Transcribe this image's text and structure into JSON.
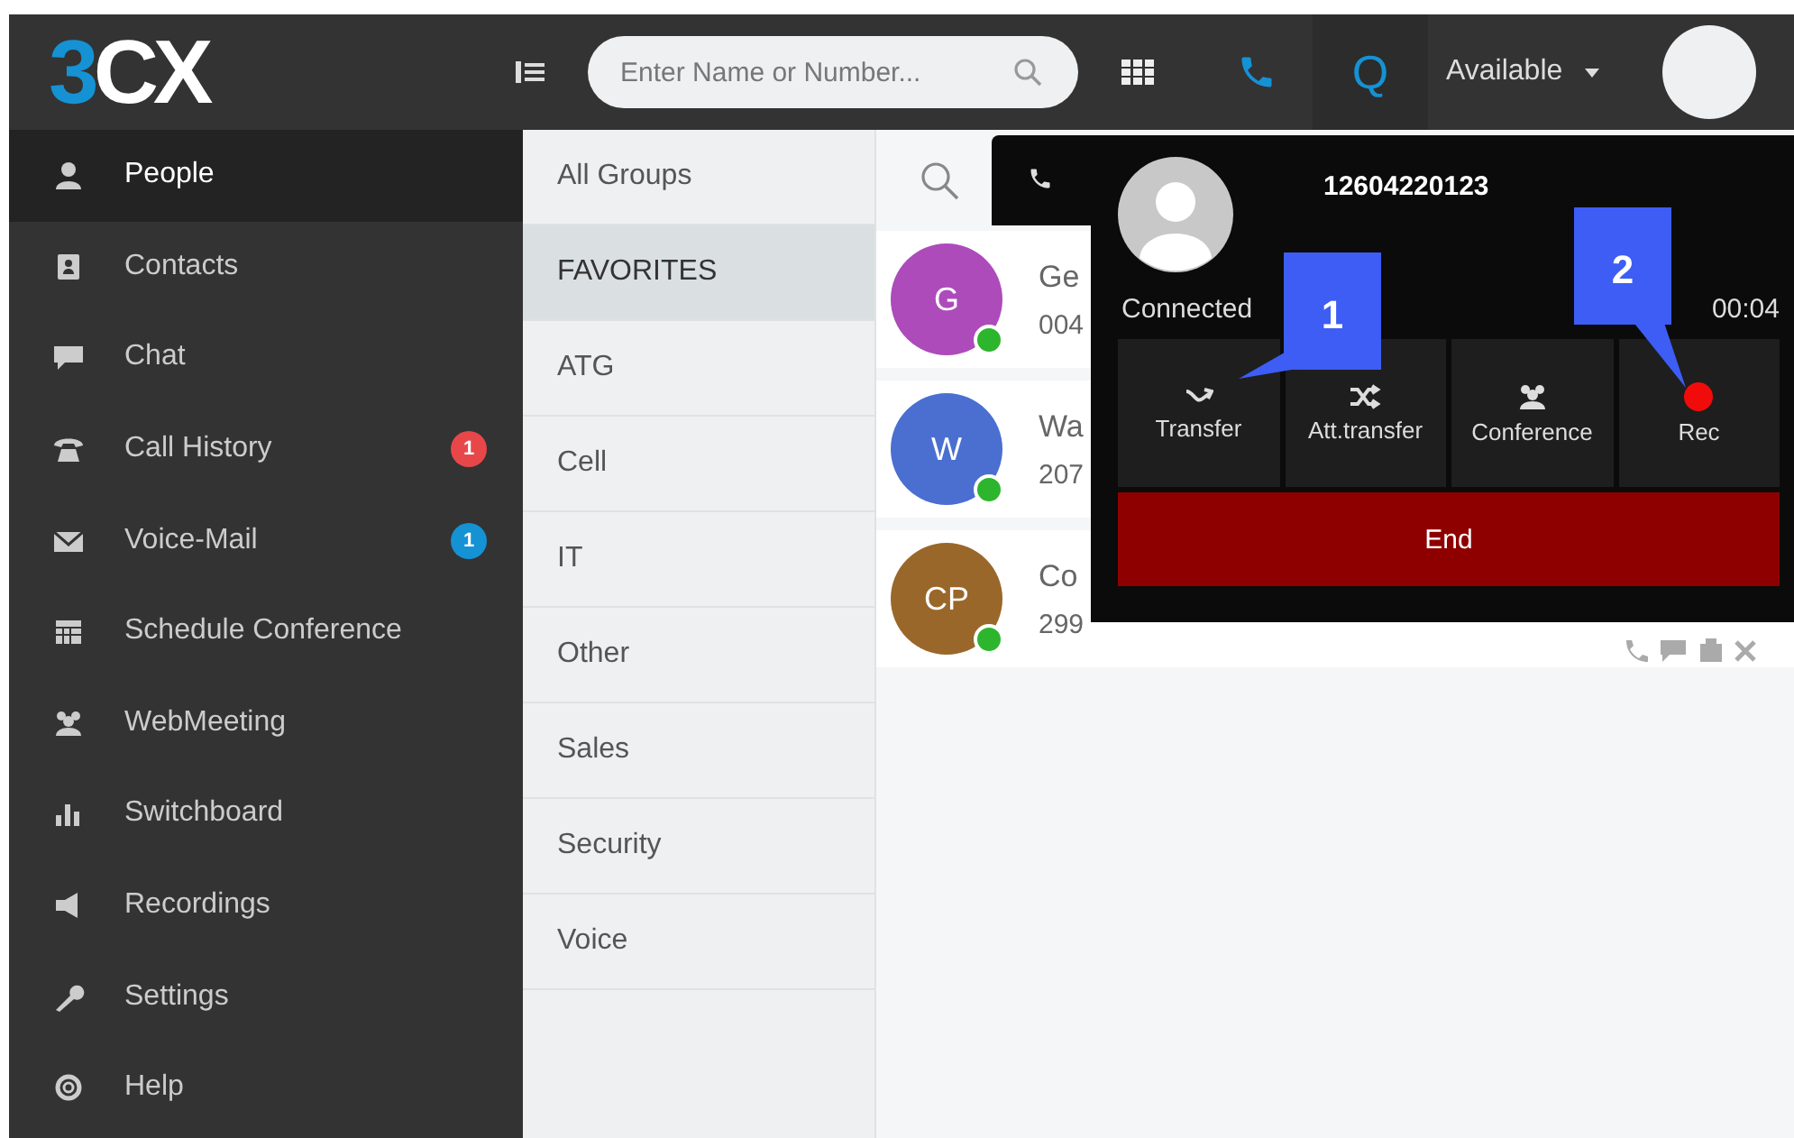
{
  "topbar": {
    "logo": {
      "accent": "3",
      "rest": "CX"
    },
    "search": {
      "placeholder": "Enter Name or Number..."
    },
    "queue_label": "Q",
    "status": "Available"
  },
  "sidebar": {
    "items": [
      {
        "label": "People",
        "selected": true
      },
      {
        "label": "Contacts",
        "selected": false
      },
      {
        "label": "Chat",
        "selected": false
      },
      {
        "label": "Call History",
        "selected": false,
        "badge": "1",
        "color": "#e8474a"
      },
      {
        "label": "Voice-Mail",
        "selected": false,
        "badge": "1",
        "color": "#1592d4"
      },
      {
        "label": "Schedule Conference",
        "selected": false
      },
      {
        "label": "WebMeeting",
        "selected": false
      },
      {
        "label": "Switchboard",
        "selected": false
      },
      {
        "label": "Recordings",
        "selected": false
      },
      {
        "label": "Settings",
        "selected": false
      },
      {
        "label": "Help",
        "selected": false
      }
    ]
  },
  "groups": [
    {
      "label": "All Groups",
      "selected": false
    },
    {
      "label": "FAVORITES",
      "selected": true
    },
    {
      "label": "ATG",
      "selected": false
    },
    {
      "label": "Cell",
      "selected": false
    },
    {
      "label": "IT",
      "selected": false
    },
    {
      "label": "Other",
      "selected": false
    },
    {
      "label": "Sales",
      "selected": false
    },
    {
      "label": "Security",
      "selected": false
    },
    {
      "label": "Voice",
      "selected": false
    }
  ],
  "contacts": [
    {
      "initials": "G",
      "color": "#ad4bbb",
      "name": "Ge",
      "number": "004",
      "online": true,
      "actions_visible": false
    },
    {
      "initials": "W",
      "color": "#4a6fd1",
      "name": "Wa",
      "number": "207",
      "online": true,
      "actions_visible": false
    },
    {
      "initials": "CP",
      "color": "#9a672a",
      "name": "Co",
      "number": "299",
      "online": true,
      "actions_visible": true
    }
  ],
  "call": {
    "number": "12604220123",
    "state": "Connected",
    "duration": "00:04",
    "actions": [
      {
        "kind": "transfer",
        "label": "Transfer"
      },
      {
        "kind": "att_transfer",
        "label": "Att.transfer"
      },
      {
        "kind": "conference",
        "label": "Conference"
      },
      {
        "kind": "rec",
        "label": "Rec"
      }
    ],
    "end_label": "End"
  },
  "annotations": [
    {
      "label": "1"
    },
    {
      "label": "2"
    }
  ]
}
